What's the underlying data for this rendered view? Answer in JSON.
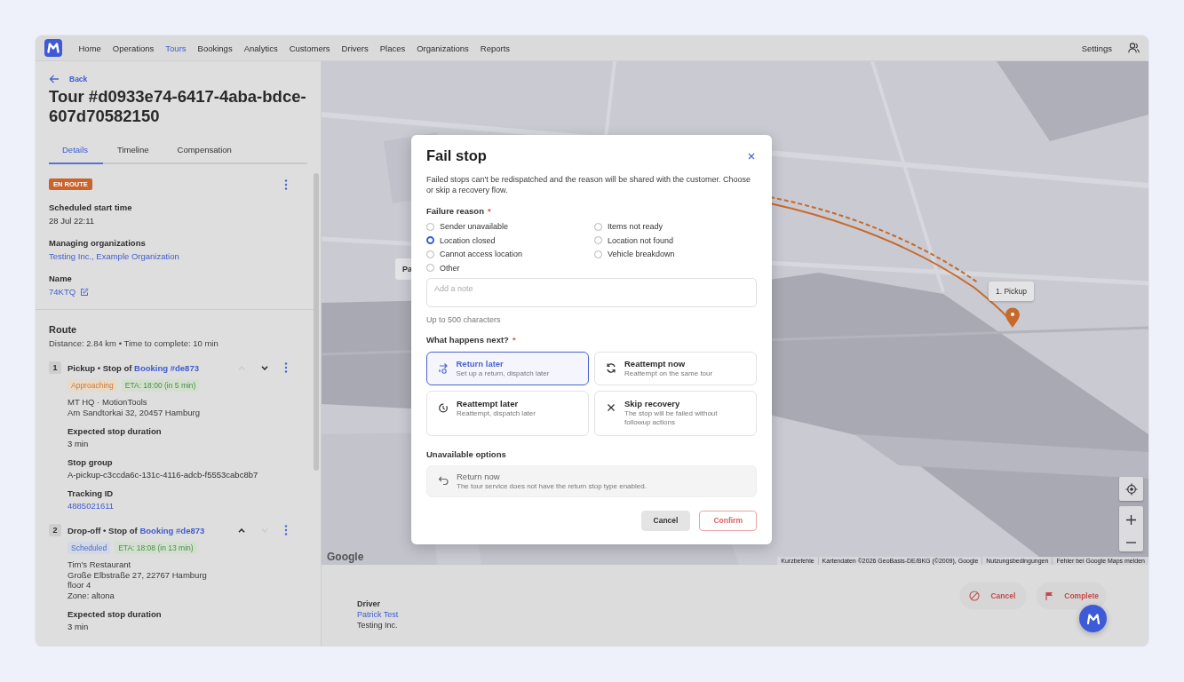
{
  "nav": {
    "items": [
      {
        "label": "Home",
        "selected": false
      },
      {
        "label": "Operations",
        "selected": false
      },
      {
        "label": "Tours",
        "selected": true
      },
      {
        "label": "Bookings",
        "selected": false
      },
      {
        "label": "Analytics",
        "selected": false
      },
      {
        "label": "Customers",
        "selected": false
      },
      {
        "label": "Drivers",
        "selected": false
      },
      {
        "label": "Places",
        "selected": false
      },
      {
        "label": "Organizations",
        "selected": false
      },
      {
        "label": "Reports",
        "selected": false
      }
    ],
    "settings": "Settings"
  },
  "header": {
    "back": "Back",
    "title": "Tour #d0933e74-6417-4aba-bdce-607d70582150"
  },
  "tabs": [
    {
      "label": "Details",
      "selected": true
    },
    {
      "label": "Timeline",
      "selected": false
    },
    {
      "label": "Compensation",
      "selected": false
    }
  ],
  "summary": {
    "status": "EN ROUTE",
    "fields": [
      {
        "label": "Scheduled start time",
        "value": "28 Jul 22:11",
        "kind": "text"
      },
      {
        "label": "Managing organizations",
        "value": "Testing Inc., Example Organization",
        "kind": "link"
      },
      {
        "label": "Name",
        "value": "74KTQ",
        "kind": "edit-link"
      }
    ]
  },
  "route": {
    "title": "Route",
    "summary": "Distance: 2.84 km • Time to complete: 10 min",
    "stops": [
      {
        "number": "1",
        "heading": "Pickup • Stop of",
        "booking": "Booking #de873",
        "up_disabled": true,
        "down_disabled": false,
        "status": {
          "label": "Approaching",
          "kind": "approaching"
        },
        "eta": "ETA: 18:00 (in 5 min)",
        "address": [
          "MT HQ · MotionTools",
          "Am Sandtorkai 32, 20457 Hamburg"
        ],
        "fields": [
          {
            "label": "Expected stop duration",
            "value": "3 min",
            "kind": "text"
          },
          {
            "label": "Stop group",
            "value": "A-pickup-c3ccda6c-131c-4116-adcb-f5553cabc8b7",
            "kind": "text"
          },
          {
            "label": "Tracking ID",
            "value": "4885021611",
            "kind": "link"
          }
        ]
      },
      {
        "number": "2",
        "heading": "Drop-off • Stop of",
        "booking": "Booking #de873",
        "up_disabled": false,
        "down_disabled": true,
        "status": {
          "label": "Scheduled",
          "kind": "scheduled"
        },
        "eta": "ETA: 18:08 (in 13 min)",
        "address": [
          "Tim's Restaurant",
          "Große Elbstraße 27, 22767 Hamburg",
          "floor 4",
          "Zone: altona"
        ],
        "fields": [
          {
            "label": "Expected stop duration",
            "value": "3 min",
            "kind": "text"
          }
        ]
      }
    ]
  },
  "map": {
    "kind": "picture",
    "pin_label": "1. Pickup",
    "partial_label": "Pa",
    "logo": "Google",
    "attribution": [
      "Kurzbefehle",
      "Kartendaten ©2026 GeoBasis-DE/BKG (©2009), Google",
      "Nutzungsbedingungen",
      "Fehler bei Google Maps melden"
    ]
  },
  "driver": {
    "label": "Driver",
    "name": "Patrick Test",
    "organization": "Testing Inc."
  },
  "actions": [
    {
      "label": "Cancel",
      "kind": "cancel"
    },
    {
      "label": "Complete",
      "kind": "complete"
    }
  ],
  "modal": {
    "title": "Fail stop",
    "description": "Failed stops can't be redispatched and the reason will be shared with the customer. Choose or skip a recovery flow.",
    "reason_label": "Failure reason",
    "reason_required": "*",
    "reasons": [
      {
        "label": "Sender unavailable",
        "selected": false
      },
      {
        "label": "Items not ready",
        "selected": false
      },
      {
        "label": "Location closed",
        "selected": true
      },
      {
        "label": "Location not found",
        "selected": false
      },
      {
        "label": "Cannot access location",
        "selected": false
      },
      {
        "label": "Vehicle breakdown",
        "selected": false
      },
      {
        "label": "Other",
        "selected": false
      }
    ],
    "note": {
      "placeholder": "Add a note",
      "hint": "Up to 500 characters"
    },
    "next_label": "What happens next?",
    "next_required": "*",
    "options": [
      {
        "kind": "return-later",
        "title": "Return later",
        "subtitle": "Set up a return, dispatch later",
        "selected": true
      },
      {
        "kind": "reattempt-now",
        "title": "Reattempt now",
        "subtitle": "Reattempt on the same tour",
        "selected": false
      },
      {
        "kind": "reattempt-later",
        "title": "Reattempt later",
        "subtitle": "Reattempt, dispatch later",
        "selected": false
      },
      {
        "kind": "skip",
        "title": "Skip recovery",
        "subtitle": "The stop will be failed without followup actions",
        "selected": false
      }
    ],
    "unavailable_label": "Unavailable options",
    "unavailable": [
      {
        "kind": "return-now",
        "title": "Return now",
        "subtitle": "The tour service does not have the return stop type enabled."
      }
    ],
    "buttons": [
      {
        "label": "Cancel",
        "kind": "secondary"
      },
      {
        "label": "Confirm",
        "kind": "danger"
      }
    ]
  }
}
